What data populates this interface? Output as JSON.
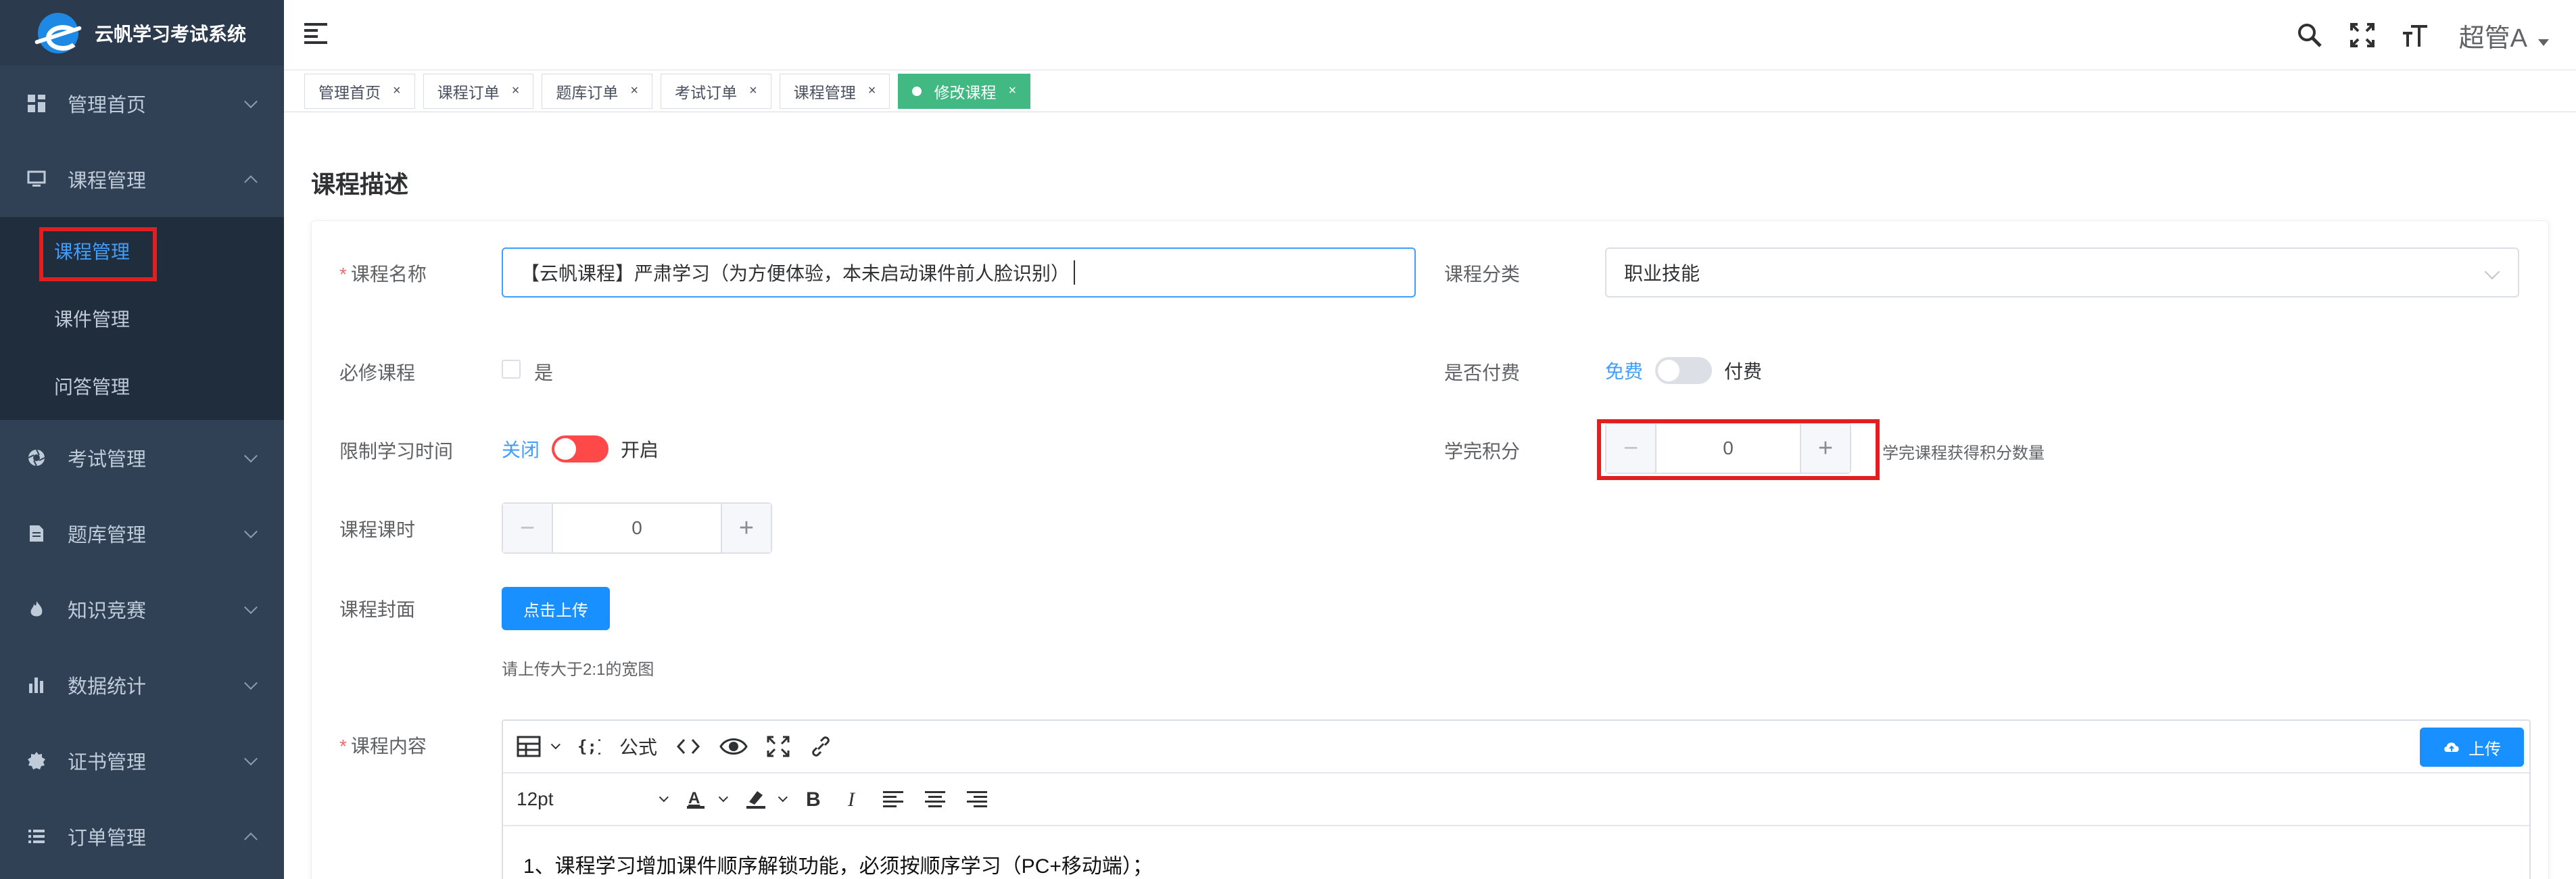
{
  "app": {
    "title": "云帆学习考试系统"
  },
  "sidebar": {
    "items": [
      {
        "label": "管理首页",
        "icon": "dashboard-icon",
        "expanded": false
      },
      {
        "label": "课程管理",
        "icon": "monitor-icon",
        "expanded": true,
        "children": [
          {
            "label": "课程管理",
            "active": true
          },
          {
            "label": "课件管理",
            "active": false
          },
          {
            "label": "问答管理",
            "active": false
          }
        ]
      },
      {
        "label": "考试管理",
        "icon": "aperture-icon",
        "expanded": false
      },
      {
        "label": "题库管理",
        "icon": "document-icon",
        "expanded": false
      },
      {
        "label": "知识竞赛",
        "icon": "fire-icon",
        "expanded": false
      },
      {
        "label": "数据统计",
        "icon": "bar-chart-icon",
        "expanded": false
      },
      {
        "label": "证书管理",
        "icon": "badge-icon",
        "expanded": false
      },
      {
        "label": "订单管理",
        "icon": "list-icon",
        "expanded": true
      }
    ]
  },
  "header": {
    "user": "超管A"
  },
  "tags": [
    {
      "label": "管理首页",
      "active": false
    },
    {
      "label": "课程订单",
      "active": false
    },
    {
      "label": "题库订单",
      "active": false
    },
    {
      "label": "考试订单",
      "active": false
    },
    {
      "label": "课程管理",
      "active": false
    },
    {
      "label": "修改课程",
      "active": true
    }
  ],
  "form": {
    "section_title": "课程描述",
    "course_name": {
      "label": "课程名称",
      "value": "【云帆课程】严肃学习（为方便体验，本未启动课件前人脸识别）"
    },
    "category": {
      "label": "课程分类",
      "value": "职业技能"
    },
    "required": {
      "label": "必修课程",
      "checkbox_label": "是",
      "checked": false
    },
    "paid": {
      "label": "是否付费",
      "off_label": "免费",
      "on_label": "付费",
      "on": false
    },
    "limit_time": {
      "label": "限制学习时间",
      "off_label": "关闭",
      "on_label": "开启",
      "on": true
    },
    "points": {
      "label": "学完积分",
      "value": "0",
      "minus": "−",
      "plus": "+",
      "hint": "学完课程获得积分数量"
    },
    "hours": {
      "label": "课程课时",
      "value": "0",
      "minus": "−",
      "plus": "+"
    },
    "cover": {
      "label": "课程封面",
      "button": "点击上传",
      "hint": "请上传大于2:1的宽图"
    },
    "content": {
      "label": "课程内容",
      "toolbar": {
        "formula": "公式",
        "font_size": "12pt",
        "upload": "上传"
      },
      "text": "1、课程学习增加课件顺序解锁功能，必须按顺序学习（PC+移动端）；"
    }
  },
  "colors": {
    "sidebar_bg": "#304156",
    "accent": "#409eff",
    "tag_active": "#42b983",
    "switch_on": "#ff4949",
    "highlight": "#e02020"
  },
  "symbols": {
    "tag_close": "×"
  }
}
